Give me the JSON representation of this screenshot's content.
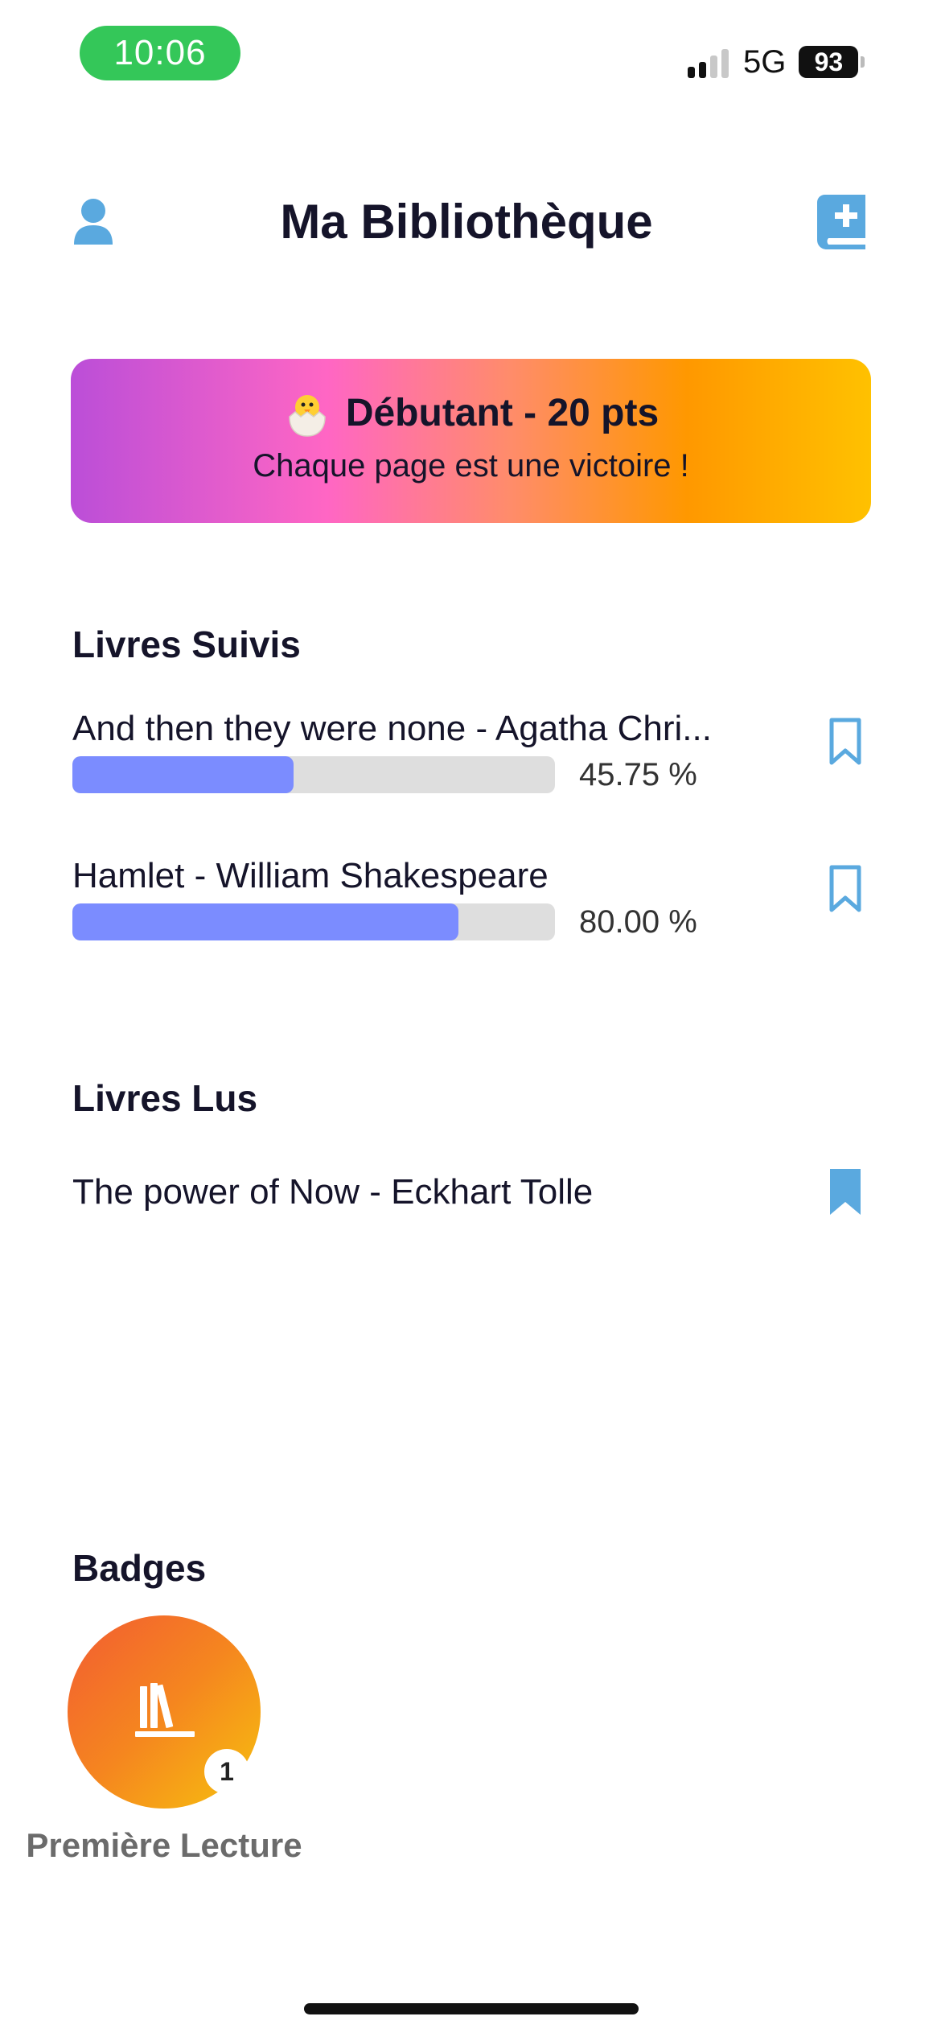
{
  "status_bar": {
    "time": "10:06",
    "network": "5G",
    "battery": "93"
  },
  "header": {
    "title": "Ma Bibliothèque",
    "left_icon": "user-icon",
    "right_icon": "add-book-icon"
  },
  "level_banner": {
    "emoji_icon": "hatching-chick-icon",
    "title": "Débutant - 20 pts",
    "subtitle": "Chaque page est une victoire !"
  },
  "tracked_books": {
    "section_title": "Livres Suivis",
    "items": [
      {
        "title": "And then they were none - Agatha Chri...",
        "progress_label": "45.75 %",
        "progress": 0.4575,
        "bookmark": "bookmark-outline-icon"
      },
      {
        "title": "Hamlet - William Shakespeare",
        "progress_label": "80.00 %",
        "progress": 0.8,
        "bookmark": "bookmark-outline-icon"
      }
    ]
  },
  "read_books": {
    "section_title": "Livres Lus",
    "items": [
      {
        "title": "The power of Now - Eckhart Tolle",
        "bookmark": "bookmark-filled-icon"
      }
    ]
  },
  "badges": {
    "section_title": "Badges",
    "items": [
      {
        "label": "Première Lecture",
        "count": "1",
        "icon": "books-icon"
      }
    ]
  },
  "colors": {
    "accent_blue": "#5aa9df",
    "progress_fill": "#7b8cff",
    "progress_track": "#dedede",
    "time_pill": "#34c759",
    "title_text": "#15142a"
  }
}
